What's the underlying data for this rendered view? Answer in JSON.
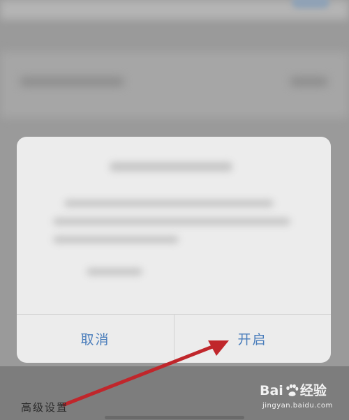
{
  "dialog": {
    "cancel_label": "取消",
    "confirm_label": "开启"
  },
  "annotation": {
    "caption": "高级设置",
    "arrow_color": "#c0262b"
  },
  "watermark": {
    "logo_left": "Bai",
    "logo_right": "经验",
    "url": "jingyan.baidu.com"
  },
  "colors": {
    "button_text": "#4a7dbb",
    "dialog_bg": "#ececec",
    "overlay_bg": "#808080"
  }
}
